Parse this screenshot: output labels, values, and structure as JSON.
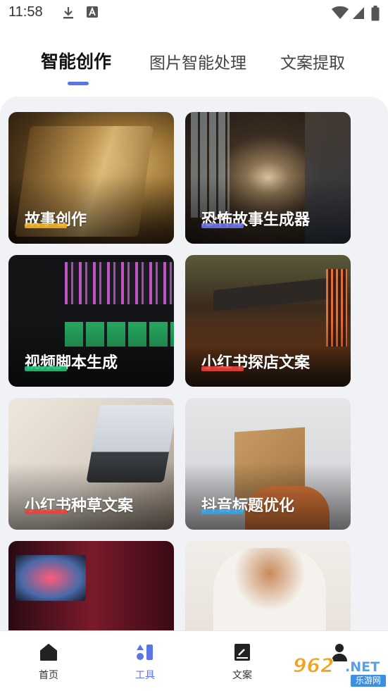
{
  "status_bar": {
    "time": "11:58"
  },
  "tabs": [
    {
      "label": "智能创作",
      "active": true
    },
    {
      "label": "图片智能处理",
      "active": false
    },
    {
      "label": "文案提取",
      "active": false
    }
  ],
  "cards": [
    {
      "title": "故事创作",
      "accent": "#f2b423"
    },
    {
      "title": "恐怖故事生成器",
      "accent": "#6b73f0"
    },
    {
      "title": "视频脚本生成",
      "accent": "#26c27a"
    },
    {
      "title": "小红书探店文案",
      "accent": "#e8423c"
    },
    {
      "title": "小红书种草文案",
      "accent": "#e8423c"
    },
    {
      "title": "抖音标题优化",
      "accent": "#2fa5e8"
    },
    {
      "title": "",
      "accent": ""
    },
    {
      "title": "",
      "accent": ""
    }
  ],
  "bottom_nav": [
    {
      "label": "首页",
      "icon": "home-icon",
      "active": false
    },
    {
      "label": "工具",
      "icon": "tools-icon",
      "active": true
    },
    {
      "label": "文案",
      "icon": "document-icon",
      "active": false
    },
    {
      "label": "",
      "icon": "profile-icon",
      "active": false
    }
  ],
  "watermark": {
    "number": "962",
    "suffix": ".NET",
    "site": "乐游网"
  },
  "colors": {
    "accent": "#5b74e6",
    "panel": "#f1f2f6"
  }
}
